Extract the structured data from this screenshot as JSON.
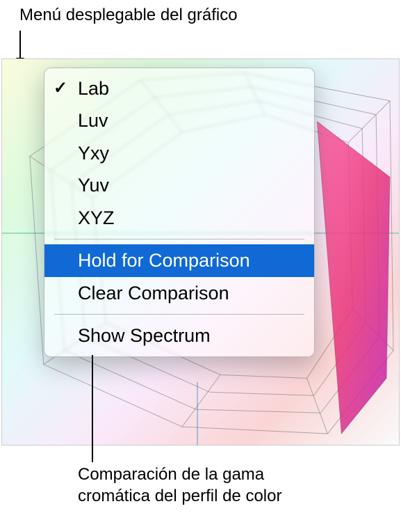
{
  "callouts": {
    "top": "Menú desplegable del gráfico",
    "bottom_line1": "Comparación de la gama",
    "bottom_line2": "cromática del perfil de color"
  },
  "menu": {
    "items": [
      {
        "label": "Lab",
        "checked": true
      },
      {
        "label": "Luv",
        "checked": false
      },
      {
        "label": "Yxy",
        "checked": false
      },
      {
        "label": "Yuv",
        "checked": false
      },
      {
        "label": "XYZ",
        "checked": false
      }
    ],
    "hold": "Hold for Comparison",
    "clear": "Clear Comparison",
    "spectrum": "Show Spectrum",
    "checkmark": "✓"
  }
}
